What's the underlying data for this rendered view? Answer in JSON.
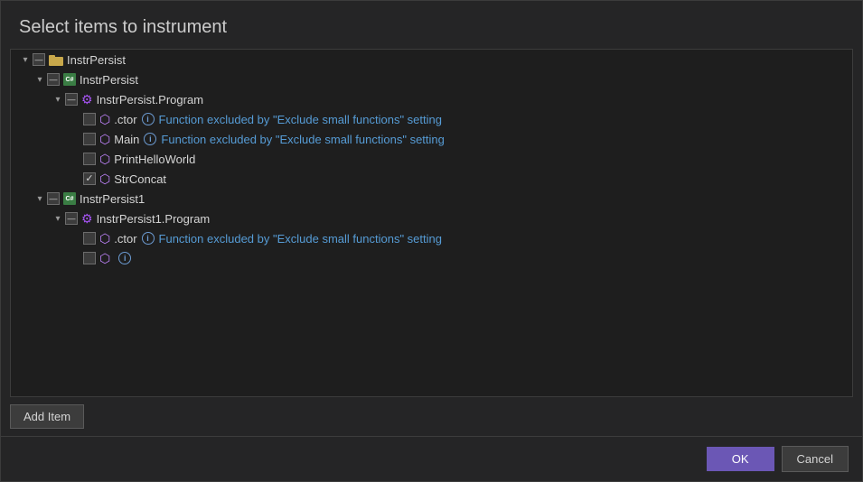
{
  "dialog": {
    "title": "Select items to instrument",
    "ok_label": "OK",
    "cancel_label": "Cancel",
    "add_item_label": "Add Item"
  },
  "tree": {
    "nodes": [
      {
        "id": "instrpersist-solution",
        "level": 0,
        "expanded": true,
        "checkbox": "indeterminate",
        "icon": "folder",
        "label": "InstrPersist"
      },
      {
        "id": "instrpersist-project",
        "level": 1,
        "expanded": true,
        "checkbox": "indeterminate",
        "icon": "csharp",
        "label": "InstrPersist"
      },
      {
        "id": "instrpersist-program-class",
        "level": 2,
        "expanded": true,
        "checkbox": "indeterminate",
        "icon": "gear-class",
        "label": "InstrPersist.Program"
      },
      {
        "id": "instrpersist-ctor",
        "level": 3,
        "expanded": false,
        "checkbox": "unchecked",
        "icon": "cube",
        "label": ".ctor",
        "excluded": true,
        "exclude_text": "Function excluded by \"Exclude small functions\" setting"
      },
      {
        "id": "instrpersist-main",
        "level": 3,
        "expanded": false,
        "checkbox": "unchecked",
        "icon": "cube",
        "label": "Main",
        "excluded": true,
        "exclude_text": "Function excluded by \"Exclude small functions\" setting"
      },
      {
        "id": "instrpersist-printhelloworld",
        "level": 3,
        "expanded": false,
        "checkbox": "unchecked",
        "icon": "cube",
        "label": "PrintHelloWorld",
        "excluded": false
      },
      {
        "id": "instrpersist-strconcat",
        "level": 3,
        "expanded": false,
        "checkbox": "checked",
        "icon": "cube",
        "label": "StrConcat",
        "excluded": false
      },
      {
        "id": "instrpersist1-project",
        "level": 1,
        "expanded": true,
        "checkbox": "indeterminate",
        "icon": "csharp",
        "label": "InstrPersist1"
      },
      {
        "id": "instrpersist1-program-class",
        "level": 2,
        "expanded": true,
        "checkbox": "indeterminate",
        "icon": "gear-class",
        "label": "InstrPersist1.Program"
      },
      {
        "id": "instrpersist1-ctor",
        "level": 3,
        "expanded": false,
        "checkbox": "unchecked",
        "icon": "cube",
        "label": ".ctor",
        "excluded": true,
        "exclude_text": "Function excluded by \"Exclude small functions\" setting"
      },
      {
        "id": "instrpersist1-main-partial",
        "level": 3,
        "expanded": false,
        "checkbox": "unchecked",
        "icon": "cube",
        "label": "",
        "excluded": true,
        "exclude_text": "",
        "partial": true
      }
    ]
  },
  "icons": {
    "folder": "📁",
    "info": "i",
    "expand": "▾",
    "collapse": "▸"
  }
}
